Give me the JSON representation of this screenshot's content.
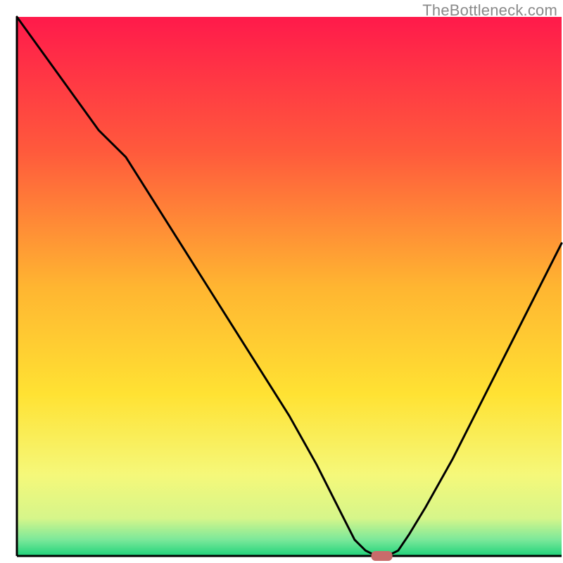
{
  "watermark": "TheBottleneck.com",
  "chart_data": {
    "type": "line",
    "title": "",
    "xlabel": "",
    "ylabel": "",
    "xlim": [
      0,
      100
    ],
    "ylim": [
      0,
      100
    ],
    "x": [
      0,
      5,
      10,
      15,
      20,
      25,
      30,
      35,
      40,
      45,
      50,
      55,
      60,
      62,
      64,
      66,
      68,
      70,
      72,
      75,
      80,
      85,
      90,
      95,
      100
    ],
    "values": [
      100,
      93,
      86,
      79,
      74,
      66,
      58,
      50,
      42,
      34,
      26,
      17,
      7,
      3,
      1,
      0,
      0,
      1,
      4,
      9,
      18,
      28,
      38,
      48,
      58
    ],
    "marker": {
      "x": 67,
      "y": 0,
      "color": "#c96b6b"
    },
    "background": {
      "type": "vertical-gradient",
      "stops": [
        {
          "pos": 0,
          "color": "#ff1a4b"
        },
        {
          "pos": 0.25,
          "color": "#ff5a3c"
        },
        {
          "pos": 0.5,
          "color": "#ffb531"
        },
        {
          "pos": 0.7,
          "color": "#ffe233"
        },
        {
          "pos": 0.85,
          "color": "#f5f87a"
        },
        {
          "pos": 0.93,
          "color": "#d6f68a"
        },
        {
          "pos": 0.97,
          "color": "#7be89a"
        },
        {
          "pos": 1.0,
          "color": "#1fd27a"
        }
      ]
    },
    "axes": {
      "color": "#000000",
      "width": 3
    },
    "line_style": {
      "color": "#000000",
      "width": 3
    }
  }
}
